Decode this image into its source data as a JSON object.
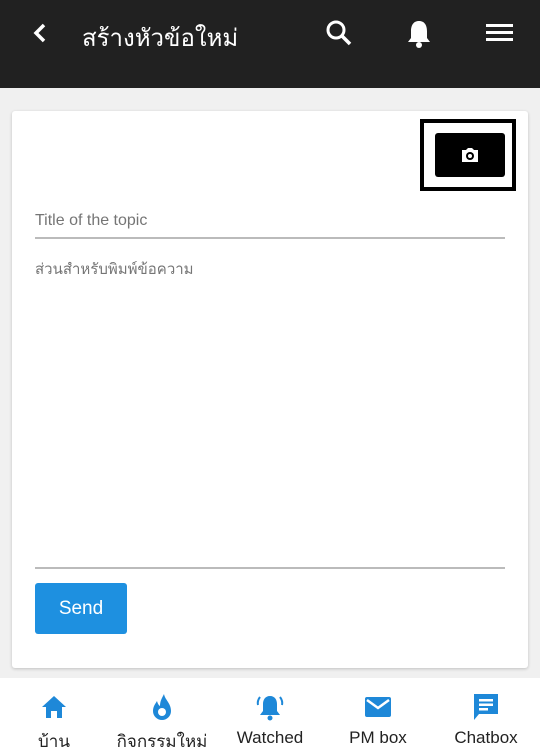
{
  "header": {
    "title": "สร้างหัวข้อใหม่",
    "back_icon": "chevron-left-icon",
    "icons": [
      "search-icon",
      "bell-icon",
      "menu-icon"
    ]
  },
  "form": {
    "title_placeholder": "Title of the topic",
    "body_placeholder": "ส่วนสำหรับพิมพ์ข้อความ",
    "send_label": "Send",
    "camera_icon": "camera-icon"
  },
  "nav": {
    "items": [
      {
        "label": "บ้าน",
        "icon": "home-icon"
      },
      {
        "label": "กิจกรรมใหม่",
        "icon": "flame-icon"
      },
      {
        "label": "Watched",
        "icon": "bell-ringing-icon"
      },
      {
        "label": "PM box",
        "icon": "mail-icon"
      },
      {
        "label": "Chatbox",
        "icon": "chat-icon"
      }
    ]
  },
  "colors": {
    "header_bg": "#212121",
    "accent": "#1e90e0"
  }
}
